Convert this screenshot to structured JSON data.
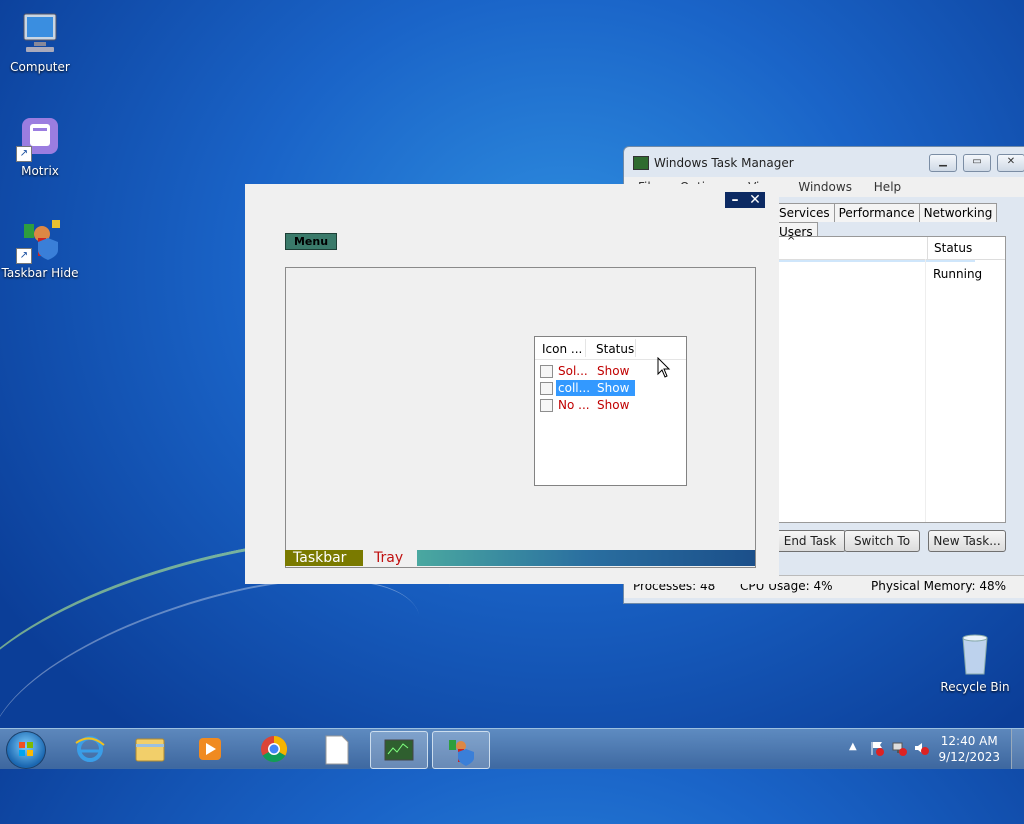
{
  "desktop": {
    "icons": [
      {
        "label": "Computer",
        "icon": "computer-icon"
      },
      {
        "label": "Motrix",
        "icon": "motrix-icon"
      },
      {
        "label": "Taskbar Hide",
        "icon": "taskbar-hide-icon"
      },
      {
        "label": "Recycle Bin",
        "icon": "recycle-bin-icon"
      }
    ]
  },
  "task_manager": {
    "title": "Windows Task Manager",
    "menu": [
      "File",
      "Options",
      "View",
      "Windows",
      "Help"
    ],
    "tabs": [
      "Services",
      "Performance",
      "Networking",
      "Users"
    ],
    "column_status": "Status",
    "row_status": "Running",
    "buttons": {
      "end_task": "End Task",
      "switch_to": "Switch To",
      "new_task": "New Task..."
    },
    "status": {
      "processes": "Processes: 48",
      "cpu": "CPU Usage: 4%",
      "memory": "Physical Memory: 48%"
    }
  },
  "app": {
    "menu_label": "Menu",
    "list": {
      "headers": [
        "Icon ...",
        "Status"
      ],
      "items": [
        {
          "name": "Sol...",
          "status": "Show",
          "selected": false
        },
        {
          "name": "coll...",
          "status": "Show",
          "selected": true
        },
        {
          "name": "No ...",
          "status": "Show",
          "selected": false
        }
      ]
    },
    "tabs": {
      "taskbar": "Taskbar",
      "tray": "Tray"
    }
  },
  "taskbar": {
    "pinned": [
      "internet-explorer-icon",
      "file-explorer-icon",
      "media-player-icon",
      "chrome-icon",
      "blank-document-icon",
      "task-manager-icon",
      "taskbar-hide-icon"
    ],
    "clock": {
      "time": "12:40 AM",
      "date": "9/12/2023"
    }
  }
}
